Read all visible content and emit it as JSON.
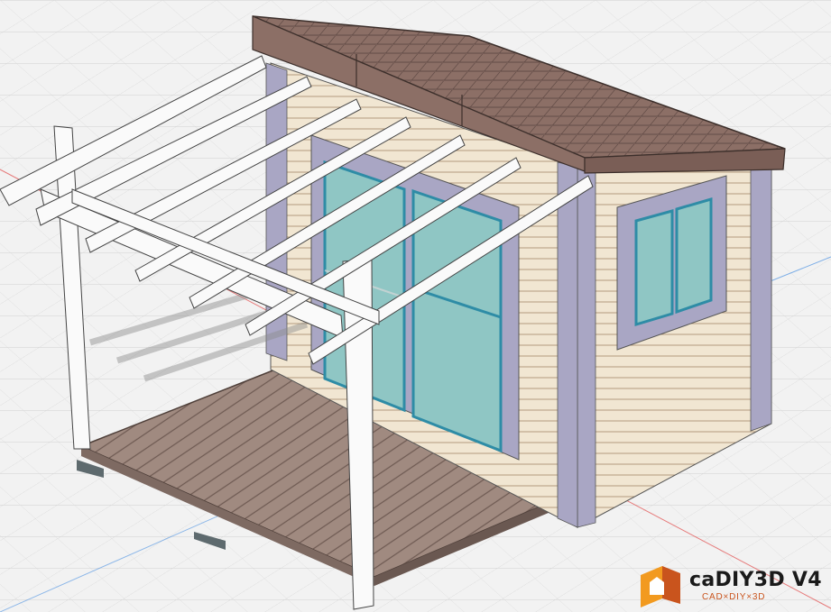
{
  "app": {
    "logo": {
      "name": "caDIY3D V4",
      "tagline": "CAD×DIY×3D",
      "icon": "cadiy3d-logo-icon",
      "colors": {
        "orange": "#f29a1f",
        "dark_orange": "#c9541d",
        "text": "#1a1a1a"
      }
    }
  },
  "viewport": {
    "background": "#f2f2f2",
    "grid_color": "#d0d0d0",
    "axis_x_color": "#e24a4a",
    "axis_y_color": "#4a90e2"
  },
  "model": {
    "type": "shed-with-pergola-deck",
    "colors": {
      "roof": "#8c6f66",
      "roof_edge": "#4a3a36",
      "siding": "#f1e6d2",
      "siding_line": "#b39a7d",
      "trim": "#a9a6c4",
      "glass": "#8fc6c4",
      "glass_frame": "#2e8ca6",
      "deck": "#a08a80",
      "deck_line": "#6e5a52",
      "post": "#fafafa",
      "foundation": "#5e6a6e"
    }
  }
}
